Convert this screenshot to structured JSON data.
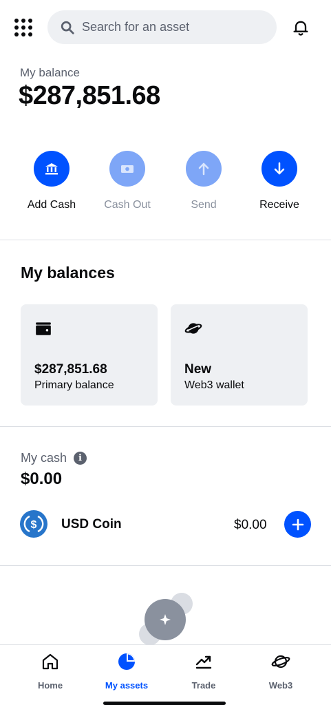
{
  "header": {
    "search_placeholder": "Search for an asset"
  },
  "balance": {
    "label": "My balance",
    "value": "$287,851.68"
  },
  "actions": [
    {
      "label": "Add Cash",
      "icon": "bank-icon",
      "enabled": true
    },
    {
      "label": "Cash Out",
      "icon": "cash-icon",
      "enabled": false
    },
    {
      "label": "Send",
      "icon": "arrow-up-icon",
      "enabled": false
    },
    {
      "label": "Receive",
      "icon": "arrow-down-icon",
      "enabled": true
    }
  ],
  "balances": {
    "title": "My balances",
    "cards": [
      {
        "value": "$287,851.68",
        "label": "Primary balance",
        "icon": "wallet-icon"
      },
      {
        "value": "New",
        "label": "Web3 wallet",
        "icon": "planet-icon"
      }
    ]
  },
  "cash": {
    "label": "My cash",
    "value": "$0.00",
    "coin": {
      "name": "USD Coin",
      "amount": "$0.00",
      "icon": "usdc-icon"
    }
  },
  "nav": [
    {
      "label": "Home",
      "icon": "home-icon",
      "active": false
    },
    {
      "label": "My assets",
      "icon": "pie-chart-icon",
      "active": true
    },
    {
      "label": "Trade",
      "icon": "trend-icon",
      "active": false
    },
    {
      "label": "Web3",
      "icon": "planet-icon",
      "active": false
    }
  ],
  "colors": {
    "accent": "#0052ff",
    "accent_disabled": "#7ea6f7",
    "card_bg": "#eef0f3",
    "muted_text": "#5b616e"
  }
}
